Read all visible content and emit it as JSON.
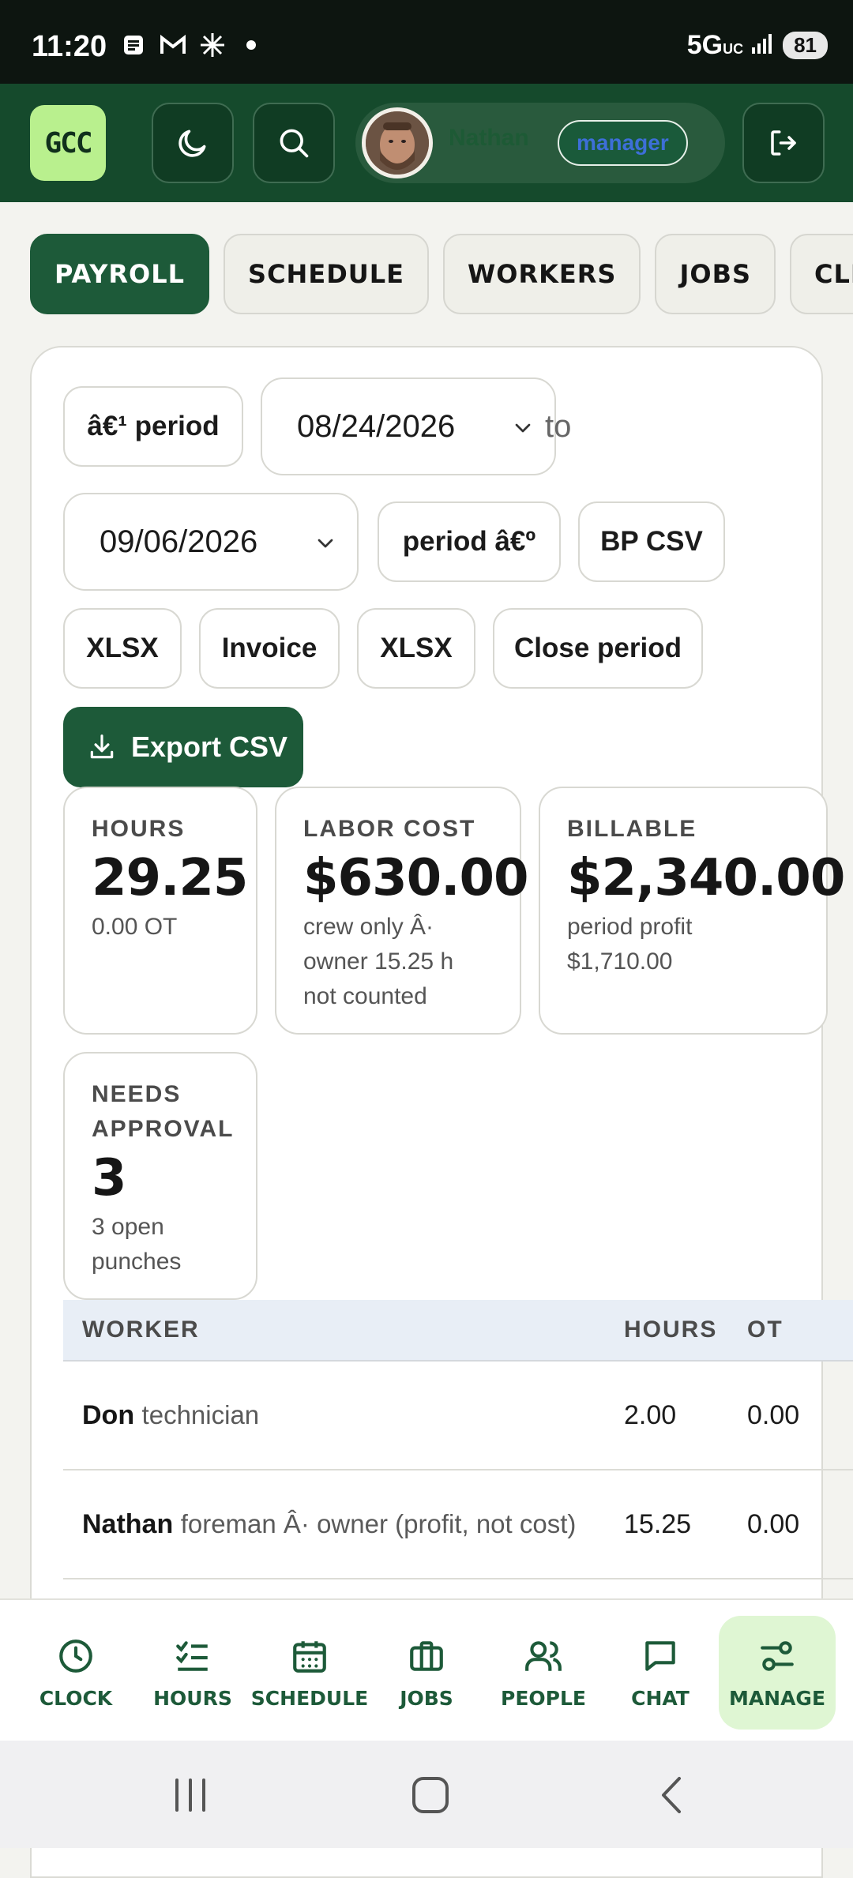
{
  "status_bar": {
    "time": "11:20",
    "network": "5G",
    "network_sub": "UC",
    "battery": "81"
  },
  "header": {
    "logo_text": "GCC",
    "user_name": "Nathan",
    "user_role": "manager"
  },
  "tabs": [
    {
      "label": "PAYROLL",
      "active": true
    },
    {
      "label": "SCHEDULE",
      "active": false
    },
    {
      "label": "WORKERS",
      "active": false
    },
    {
      "label": "JOBS",
      "active": false
    },
    {
      "label": "CLIENTS",
      "active": false
    }
  ],
  "payroll": {
    "prev_period_label": "â€¹ period",
    "start_date": "08/24/2026",
    "to_label": "to",
    "end_date": "09/06/2026",
    "next_period_label": "period â€º",
    "bp_csv_label": "BP CSV",
    "xlsx_label_1": "XLSX",
    "invoice_label": "Invoice",
    "xlsx_label_2": "XLSX",
    "close_period_label": "Close period",
    "export_csv_label": "Export CSV"
  },
  "cards": {
    "hours": {
      "label": "HOURS",
      "value": "29.25",
      "sub": "0.00 OT"
    },
    "labor_cost": {
      "label": "LABOR COST",
      "value": "$630.00",
      "sub": "crew only Â· owner 15.25 h not counted"
    },
    "billable": {
      "label": "BILLABLE",
      "value": "$2,340.00",
      "sub": "period profit $1,710.00"
    },
    "needs_approval": {
      "label": "NEEDS APPROVAL",
      "value": "3",
      "sub": "3 open punches"
    }
  },
  "table": {
    "headers": {
      "worker": "WORKER",
      "hours": "HOURS",
      "ot": "OT"
    },
    "rows": [
      {
        "name": "Don",
        "role": "technician",
        "hours": "2.00",
        "ot": "0.00"
      },
      {
        "name": "Nathan",
        "role": "foreman Â· owner (profit, not cost)",
        "hours": "15.25",
        "ot": "0.00"
      }
    ]
  },
  "bottom_nav": [
    {
      "label": "CLOCK",
      "icon": "clock-icon"
    },
    {
      "label": "HOURS",
      "icon": "checklist-icon"
    },
    {
      "label": "SCHEDULE",
      "icon": "calendar-icon"
    },
    {
      "label": "JOBS",
      "icon": "briefcase-icon"
    },
    {
      "label": "PEOPLE",
      "icon": "people-icon"
    },
    {
      "label": "CHAT",
      "icon": "chat-icon"
    },
    {
      "label": "MANAGE",
      "icon": "sliders-icon",
      "active": true
    }
  ],
  "colors": {
    "brand_dark": "#154a2c",
    "accent_green": "#1d5a39",
    "logo_lime": "#b9f08e",
    "active_nav_bg": "#dff6d3"
  }
}
